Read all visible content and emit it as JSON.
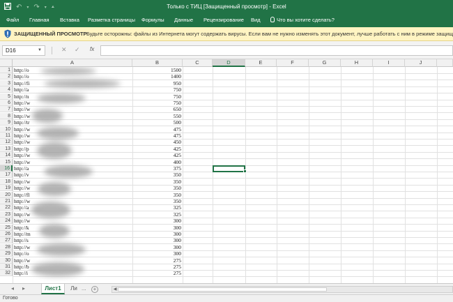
{
  "window": {
    "title": "Только с ТИЦ  [Защищенный просмотр]  -  Excel",
    "accent": "#217346"
  },
  "qat": {
    "save_icon": "save-icon",
    "undo_icon": "undo-icon",
    "redo_icon": "redo-icon",
    "customize_icon": "chevron-down-icon"
  },
  "ribbon": {
    "tabs": [
      "Файл",
      "Главная",
      "Вставка",
      "Разметка страницы",
      "Формулы",
      "Данные",
      "Рецензирование",
      "Вид"
    ],
    "tell_me": "Что вы хотите сделать?"
  },
  "protected_view": {
    "title": "ЗАЩИЩЕННЫЙ ПРОСМОТР",
    "message": "Будьте осторожны: файлы из Интернета могут содержать вирусы. Если вам не нужно изменять этот документ, лучше работать с ним в режиме защищенного просмо"
  },
  "formula_bar": {
    "name_box": "D16",
    "fx_label": "fx",
    "cancel_icon": "close-icon",
    "enter_icon": "check-icon",
    "value": ""
  },
  "grid": {
    "columns": [
      "A",
      "B",
      "C",
      "D",
      "E",
      "F",
      "G",
      "H",
      "I",
      "J"
    ],
    "selected_column": "D",
    "selected_row": 16,
    "rows": [
      {
        "n": "1",
        "a": "http://o",
        "b": "1500"
      },
      {
        "n": "2",
        "a": "http://o",
        "b": "1400"
      },
      {
        "n": "3",
        "a": "http://fi",
        "b": "950"
      },
      {
        "n": "4",
        "a": "http://a",
        "b": "750"
      },
      {
        "n": "5",
        "a": "http://n",
        "b": "750"
      },
      {
        "n": "6",
        "a": "http://w",
        "b": "750"
      },
      {
        "n": "7",
        "a": "http://w",
        "b": "650"
      },
      {
        "n": "8",
        "a": "http://w",
        "b": "550"
      },
      {
        "n": "9",
        "a": "http://tr",
        "b": "500"
      },
      {
        "n": "10",
        "a": "http://w",
        "b": "475"
      },
      {
        "n": "11",
        "a": "http://w",
        "b": "475"
      },
      {
        "n": "12",
        "a": "http://w",
        "b": "450"
      },
      {
        "n": "13",
        "a": "http://p",
        "b": "425"
      },
      {
        "n": "14",
        "a": "http://w",
        "b": "425"
      },
      {
        "n": "15",
        "a": "http://w",
        "b": "400"
      },
      {
        "n": "16",
        "a": "http://a",
        "b": "375"
      },
      {
        "n": "17",
        "a": "http://v",
        "b": "350"
      },
      {
        "n": "18",
        "a": "http://w",
        "b": "350"
      },
      {
        "n": "19",
        "a": "http://w",
        "b": "350"
      },
      {
        "n": "20",
        "a": "http://fl",
        "b": "350"
      },
      {
        "n": "21",
        "a": "http://w",
        "b": "350"
      },
      {
        "n": "22",
        "a": "http://a",
        "b": "325"
      },
      {
        "n": "23",
        "a": "http://w",
        "b": "325"
      },
      {
        "n": "24",
        "a": "http://w",
        "b": "300"
      },
      {
        "n": "25",
        "a": "http://k",
        "b": "300"
      },
      {
        "n": "26",
        "a": "http://m",
        "b": "300"
      },
      {
        "n": "27",
        "a": "http://s",
        "b": "300"
      },
      {
        "n": "28",
        "a": "http://w",
        "b": "300"
      },
      {
        "n": "29",
        "a": "http://o",
        "b": "300"
      },
      {
        "n": "30",
        "a": "http://w",
        "b": "275"
      },
      {
        "n": "31",
        "a": "http://b",
        "b": "275"
      },
      {
        "n": "32",
        "a": "http://i",
        "b": "275"
      }
    ]
  },
  "sheet_tabs": {
    "active": "Лист1",
    "other": "Ли",
    "ellipsis": "...",
    "add": "+"
  },
  "status_bar": {
    "text": "Готово"
  }
}
